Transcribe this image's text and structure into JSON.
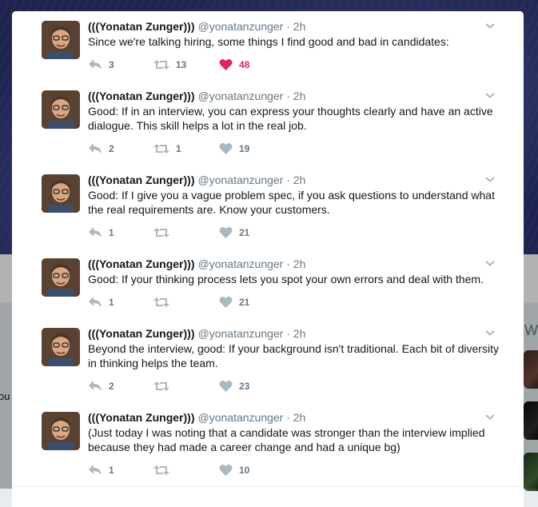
{
  "colors": {
    "link_gray": "#657786",
    "text": "#14171a",
    "like_red": "#e0245e",
    "icon_gray": "#aab8c2"
  },
  "background": {
    "cut_text": "ou",
    "right_heading": "W"
  },
  "tweets": [
    {
      "fullname": "(((Yonatan Zunger)))",
      "username": "@yonatanzunger",
      "separator": "·",
      "time": "2h",
      "text": "Since we're talking hiring, some things I find good and bad in candidates:",
      "replies": "3",
      "retweets": "13",
      "likes": "48",
      "liked": true
    },
    {
      "fullname": "(((Yonatan Zunger)))",
      "username": "@yonatanzunger",
      "separator": "·",
      "time": "2h",
      "text": "Good: If in an interview, you can express your thoughts clearly and have an active dialogue. This skill helps a lot in the real job.",
      "replies": "2",
      "retweets": "1",
      "likes": "19",
      "liked": false
    },
    {
      "fullname": "(((Yonatan Zunger)))",
      "username": "@yonatanzunger",
      "separator": "·",
      "time": "2h",
      "text": "Good: If I give you a vague problem spec, if you ask questions to understand what the real requirements are. Know your customers.",
      "replies": "1",
      "retweets": "",
      "likes": "21",
      "liked": false
    },
    {
      "fullname": "(((Yonatan Zunger)))",
      "username": "@yonatanzunger",
      "separator": "·",
      "time": "2h",
      "text": "Good: If your thinking process lets you spot your own errors and deal with them.",
      "replies": "1",
      "retweets": "",
      "likes": "21",
      "liked": false
    },
    {
      "fullname": "(((Yonatan Zunger)))",
      "username": "@yonatanzunger",
      "separator": "·",
      "time": "2h",
      "text": "Beyond the interview, good: If your background isn't traditional. Each bit of diversity in thinking helps the team.",
      "replies": "2",
      "retweets": "",
      "likes": "23",
      "liked": false
    },
    {
      "fullname": "(((Yonatan Zunger)))",
      "username": "@yonatanzunger",
      "separator": "·",
      "time": "2h",
      "text": "(Just today I was noting that a candidate was stronger than the interview implied because they had made a career change and had a unique bg)",
      "replies": "1",
      "retweets": "",
      "likes": "10",
      "liked": false
    }
  ]
}
